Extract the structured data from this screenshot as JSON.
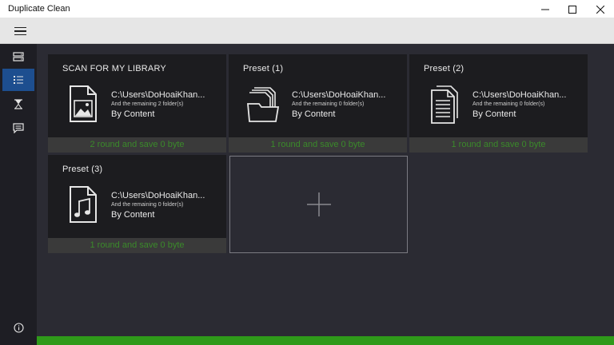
{
  "window": {
    "title": "Duplicate Clean",
    "minimize_icon": "minimize-icon",
    "maximize_icon": "maximize-icon",
    "close_icon": "close-icon"
  },
  "toolbar": {
    "menu_icon": "hamburger-menu-icon"
  },
  "sidebar": {
    "items": [
      {
        "icon": "server-icon",
        "active": false
      },
      {
        "icon": "list-icon",
        "active": true
      },
      {
        "icon": "hourglass-icon",
        "active": false
      },
      {
        "icon": "message-icon",
        "active": false
      }
    ],
    "bottom_icon": "info-icon"
  },
  "cards": [
    {
      "title": "SCAN FOR MY LIBRARY",
      "icon": "image-file-icon",
      "path": "C:\\Users\\DoHoaiKhan...",
      "remaining": "And the remaining 2 folder(s)",
      "mode": "By Content",
      "footer": "2 round and save 0 byte"
    },
    {
      "title": "Preset (1)",
      "icon": "folder-files-icon",
      "path": "C:\\Users\\DoHoaiKhan...",
      "remaining": "And the remaining 0 folder(s)",
      "mode": "By Content",
      "footer": "1 round and save 0 byte"
    },
    {
      "title": "Preset (2)",
      "icon": "documents-icon",
      "path": "C:\\Users\\DoHoaiKhan...",
      "remaining": "And the remaining 0 folder(s)",
      "mode": "By Content",
      "footer": "1 round and save 0 byte"
    },
    {
      "title": "Preset (3)",
      "icon": "music-file-icon",
      "path": "C:\\Users\\DoHoaiKhan...",
      "remaining": "And the remaining 0 folder(s)",
      "mode": "By Content",
      "footer": "1 round and save 0 byte"
    }
  ],
  "add_card": {
    "icon": "plus-icon"
  },
  "colors": {
    "accent_active": "#1d4e8f",
    "footer_text": "#3a8a2a",
    "status_bar": "#2f9a1a"
  }
}
